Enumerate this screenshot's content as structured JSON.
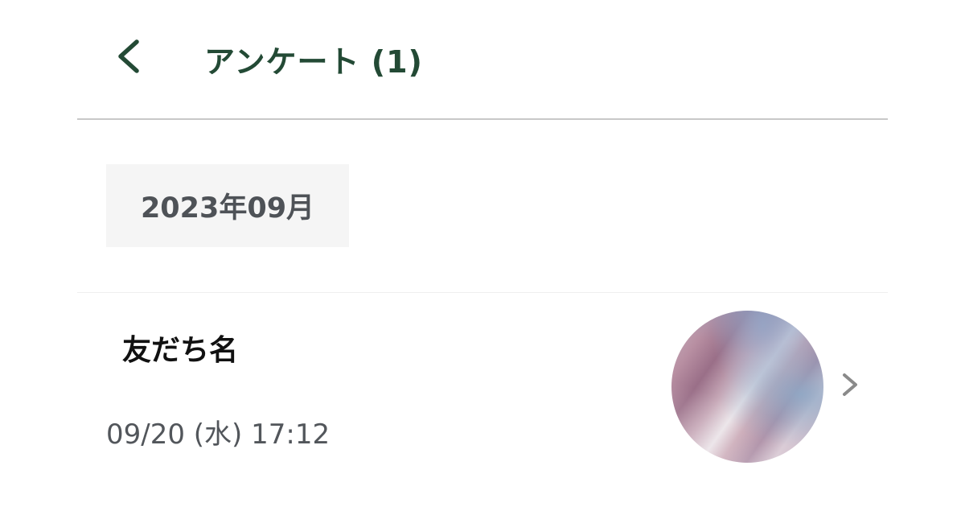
{
  "header": {
    "title": "アンケート (1)",
    "back_icon": "chevron-left-icon",
    "accent_color": "#234a35"
  },
  "month_chip": {
    "label": "2023年09月"
  },
  "list": {
    "items": [
      {
        "friend_name": "友だち名",
        "timestamp": "09/20 (水)  17:12",
        "avatar": "gradient-avatar",
        "trailing_icon": "chevron-right-icon"
      }
    ]
  }
}
